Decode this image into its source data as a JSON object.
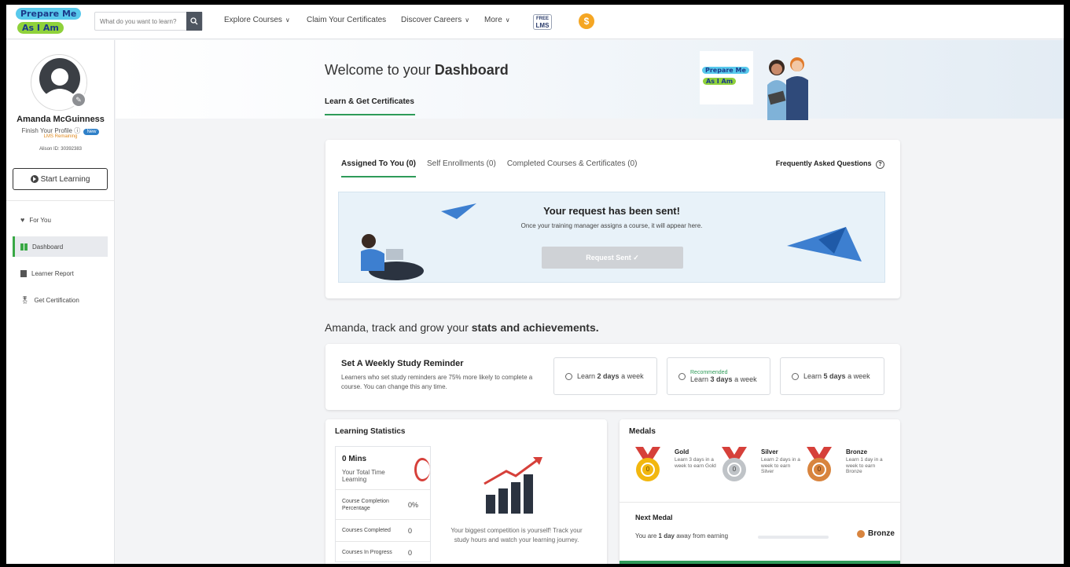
{
  "header": {
    "logo_line1": "Prepare Me",
    "logo_line2": "As I Am",
    "search_placeholder": "What do you want to learn?",
    "nav": {
      "explore": "Explore Courses",
      "claim": "Claim Your Certificates",
      "discover": "Discover Careers",
      "more": "More"
    },
    "free_lms_line1": "FREE",
    "free_lms_line2": "LMS",
    "coin_symbol": "$"
  },
  "sidebar": {
    "user_name": "Amanda McGuinness",
    "finish_profile": "Finish Your Profile",
    "new_badge": "New",
    "lms_remaining": "LMS Remaining",
    "alison_id": "Alison ID: 30392383",
    "start_learning": "Start Learning",
    "items": [
      {
        "label": "For You",
        "icon": "heart-icon"
      },
      {
        "label": "Dashboard",
        "icon": "dashboard-icon"
      },
      {
        "label": "Learner Report",
        "icon": "report-icon"
      },
      {
        "label": "Get Certification",
        "icon": "certification-icon"
      }
    ]
  },
  "hero": {
    "welcome_prefix": "Welcome to your ",
    "welcome_bold": "Dashboard",
    "tab_label": "Learn & Get Certificates",
    "logo_line1": "Prepare Me",
    "logo_line2": "As I Am"
  },
  "courses_card": {
    "tabs": [
      "Assigned To You (0)",
      "Self Enrollments (0)",
      "Completed Courses & Certificates (0)"
    ],
    "faq": "Frequently Asked Questions",
    "request_title": "Your request has been sent!",
    "request_sub": "Once your training manager assigns a course, it will appear here.",
    "request_button": "Request Sent ✓"
  },
  "track": {
    "prefix": "Amanda, track and grow your ",
    "bold": "stats and achievements."
  },
  "reminder": {
    "title": "Set A Weekly Study Reminder",
    "description": "Learners who set study reminders are 75% more likely to complete a course. You can change this any time.",
    "options": [
      {
        "prefix": "Learn ",
        "bold": "2 days",
        "suffix": " a week",
        "recommended": ""
      },
      {
        "prefix": "Learn ",
        "bold": "3 days",
        "suffix": " a week",
        "recommended": "Recommended"
      },
      {
        "prefix": "Learn ",
        "bold": "5 days",
        "suffix": " a week",
        "recommended": ""
      }
    ]
  },
  "stats": {
    "title": "Learning Statistics",
    "total_time_value": "0 Mins",
    "total_time_label": "Your Total Time Learning",
    "rows": [
      {
        "label": "Course Completion Percentage",
        "value": "0%"
      },
      {
        "label": "Courses Completed",
        "value": "0"
      },
      {
        "label": "Courses In Progress",
        "value": "0"
      }
    ],
    "motivation": "Your biggest competition is yourself! Track your study hours and watch your learning journey."
  },
  "medals": {
    "title": "Medals",
    "items": [
      {
        "name": "Gold",
        "desc": "Learn 3 days in a week to earn Gold",
        "count": "0",
        "color": "#f2b70f"
      },
      {
        "name": "Silver",
        "desc": "Learn 2 days in a week to earn Silver",
        "count": "0",
        "color": "#bfc3c7"
      },
      {
        "name": "Bronze",
        "desc": "Learn 1 day in a week to earn Bronze",
        "count": "0",
        "color": "#d8843e"
      }
    ],
    "next_title": "Next Medal",
    "next_prefix": "You are ",
    "next_bold": "1 day",
    "next_suffix": " away from earning",
    "next_medal": "Bronze"
  },
  "colors": {
    "accent_green": "#2e9b59",
    "badge_blue": "#2f80c8",
    "coin_orange": "#f5a623",
    "ribbon_red": "#d6403a"
  }
}
